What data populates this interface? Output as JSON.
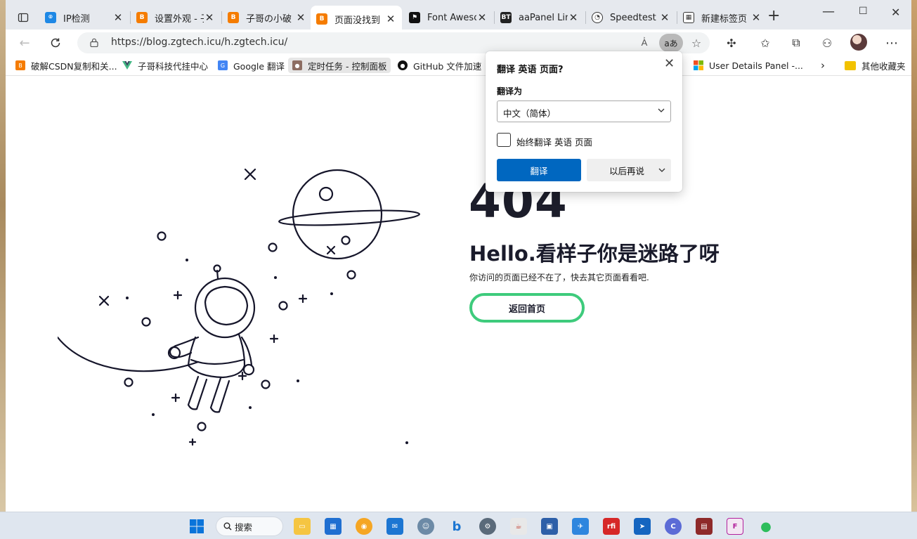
{
  "tabs": [
    {
      "title": "IP检测",
      "favicon": "ip-icon",
      "color": "#1e88e5"
    },
    {
      "title": "设置外观 - 子",
      "favicon": "blogger-icon",
      "color": "#f57c00"
    },
    {
      "title": "子哥の小破",
      "favicon": "blogger-icon",
      "color": "#f57c00"
    },
    {
      "title": "页面没找到",
      "favicon": "blogger-icon",
      "color": "#f57c00",
      "active": true
    },
    {
      "title": "Font Awesome",
      "favicon": "flag-icon",
      "color": "#111111"
    },
    {
      "title": "aaPanel Linux",
      "favicon": "bt-icon",
      "color": "#222222"
    },
    {
      "title": "Speedtest C",
      "favicon": "speedometer-icon",
      "color": "#333333"
    },
    {
      "title": "新建标签页",
      "favicon": "newtab-icon",
      "color": "#333333"
    }
  ],
  "address": {
    "url": "https://blog.zgtech.icu/h.zgtech.icu/"
  },
  "translate_pill": "aあ",
  "bookmarks": [
    {
      "label": "破解CSDN复制和关...",
      "icon": "blogger-icon",
      "color": "#f57c00"
    },
    {
      "label": "子哥科技代挂中心",
      "icon": "vue-icon",
      "color": "#41b883"
    },
    {
      "label": "Google 翻译",
      "icon": "google-translate-icon",
      "color": "#4285f4"
    },
    {
      "label": "定时任务 - 控制面板",
      "icon": "cow-icon",
      "color": "#8d6e63"
    },
    {
      "label": "GitHub 文件加速",
      "icon": "github-icon",
      "color": "#111111"
    },
    {
      "label": "User Details Panel -...",
      "icon": "microsoft-icon",
      "color": "#f25022"
    },
    {
      "label": "其他收藏夹",
      "icon": "folder-icon",
      "color": "#f2c200"
    }
  ],
  "page": {
    "code": "404",
    "headline": "Hello.看样子你是迷路了呀",
    "subtext": "你访问的页面已经不在了，快去其它页面看看吧.",
    "back_button": "返回首页"
  },
  "translate_popup": {
    "title": "翻译 英语 页面?",
    "translate_to_label": "翻译为",
    "selected_language": "中文（简体）",
    "always_translate_label": "始终翻译 英语 页面",
    "always_translate_checked": false,
    "translate_button": "翻译",
    "later_button": "以后再说"
  },
  "taskbar": {
    "search_label": "搜索"
  }
}
